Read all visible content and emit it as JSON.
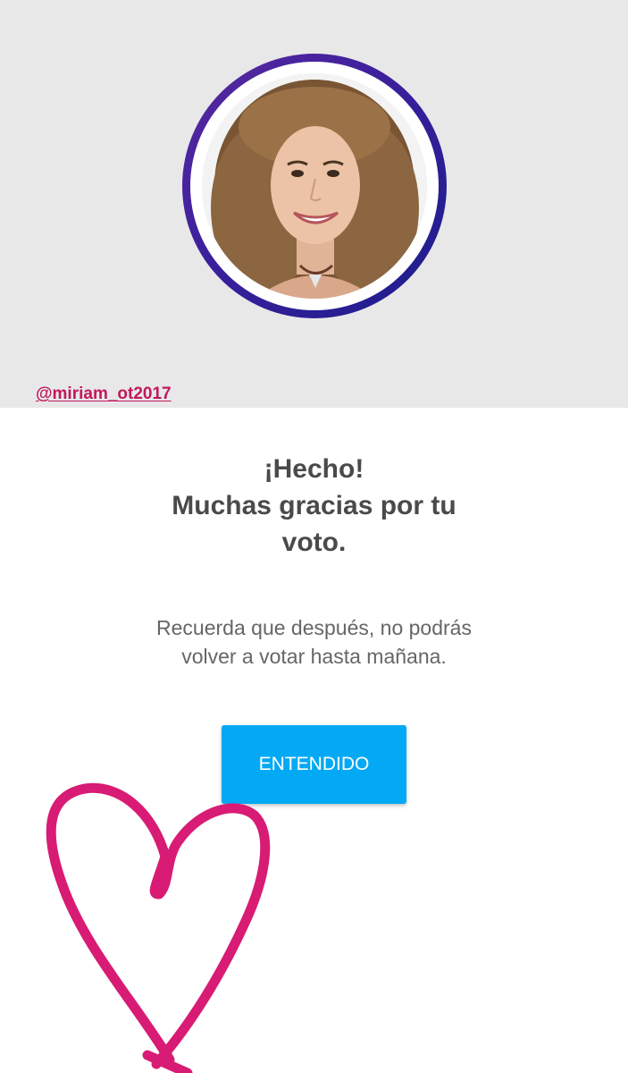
{
  "profile": {
    "handle": "@miriam_ot2017"
  },
  "confirmation": {
    "title_line1": "¡Hecho!",
    "title_line2": "Muchas gracias por tu",
    "title_line3": "voto.",
    "note_line1": "Recuerda que después, no podrás",
    "note_line2": "volver a votar hasta mañana.",
    "button_label": "ENTENDIDO"
  },
  "icons": {
    "drawing": "heart-doodle",
    "avatar": "profile-photo"
  },
  "colors": {
    "top_background": "#e8e8e9",
    "handle": "#c2185b",
    "title": "#4a4a4a",
    "note": "#666666",
    "button": "#03a9f4",
    "button_text": "#ffffff",
    "heart": "#d81b74"
  }
}
